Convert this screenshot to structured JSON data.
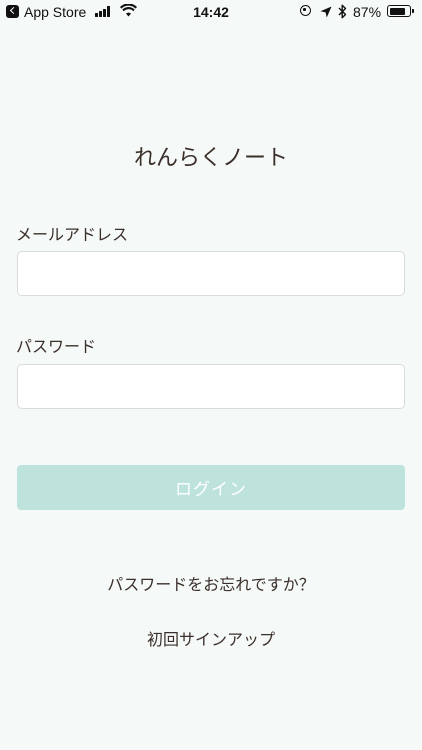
{
  "status_bar": {
    "back_app": "App Store",
    "time": "14:42",
    "battery_percent": "87%",
    "battery_level": 0.87,
    "icons": [
      "back-icon",
      "signal-icon",
      "wifi-icon",
      "rotation-lock-icon",
      "location-icon",
      "bluetooth-icon",
      "battery-icon"
    ]
  },
  "app": {
    "title": "れんらくノート"
  },
  "form": {
    "email_label": "メールアドレス",
    "email_value": "",
    "password_label": "パスワード",
    "password_value": "",
    "login_label": "ログイン"
  },
  "links": {
    "forgot_password": "パスワードをお忘れですか？",
    "signup": "初回サインアップ"
  },
  "colors": {
    "background": "#f5f9f8",
    "button_disabled": "#bde3dc",
    "text": "#3b2f2a",
    "input_border": "#d9dcdb"
  }
}
